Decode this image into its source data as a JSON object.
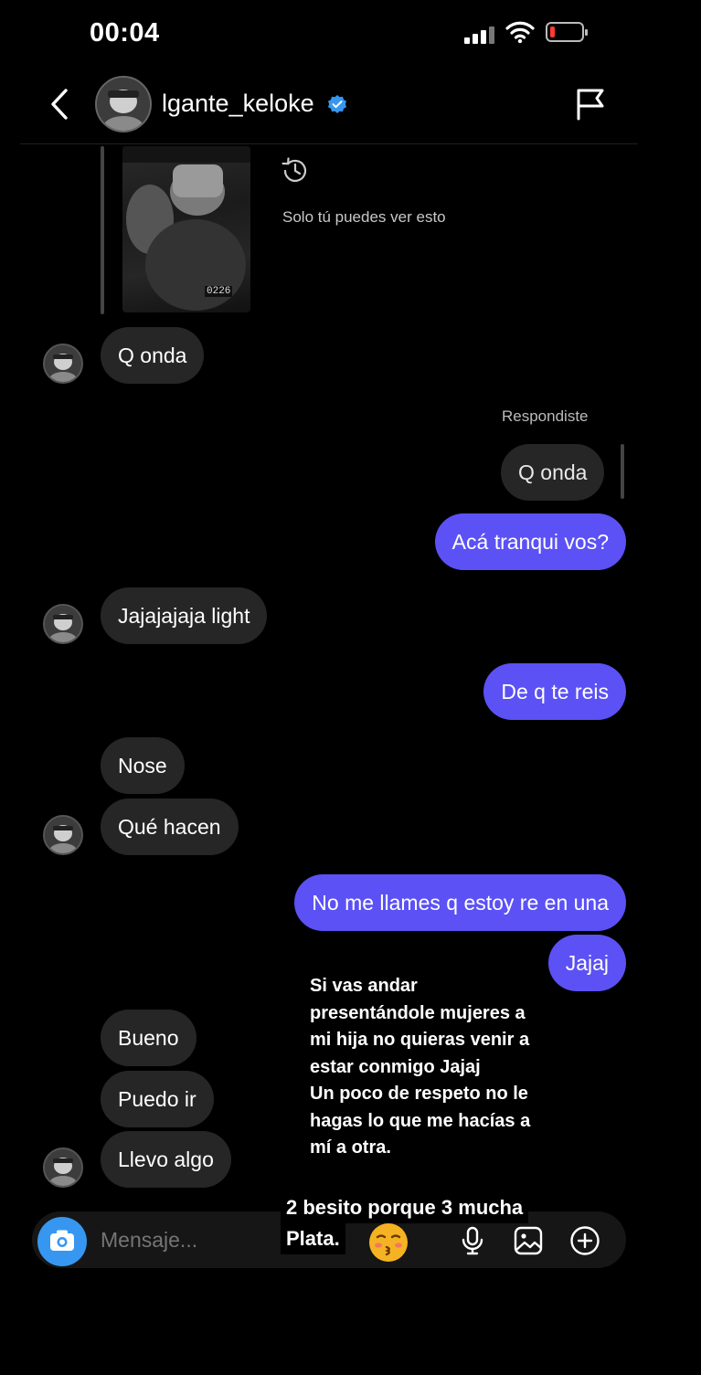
{
  "status_bar": {
    "time": "00:04"
  },
  "header": {
    "username": "lgante_keloke"
  },
  "story": {
    "timer": "0226",
    "note": "Solo tú puedes ver esto"
  },
  "replied_label": "Respondiste",
  "messages": [
    {
      "side": "in",
      "text": "Q onda"
    },
    {
      "side": "echo",
      "text": "Q onda"
    },
    {
      "side": "out",
      "text": "Acá tranqui vos?"
    },
    {
      "side": "in",
      "text": "Jajajajaja light"
    },
    {
      "side": "out",
      "text": "De q te reis"
    },
    {
      "side": "in",
      "text": "Nose"
    },
    {
      "side": "in",
      "text": "Qué hacen"
    },
    {
      "side": "out",
      "text": "No me llames q estoy re en una"
    },
    {
      "side": "out",
      "text": "Jajaj"
    },
    {
      "side": "in",
      "text": "Bueno"
    },
    {
      "side": "in",
      "text": "Puedo ir"
    },
    {
      "side": "in",
      "text": "Llevo algo"
    }
  ],
  "overlay_text": {
    "lines": [
      "Si vas andar",
      "presentándole mujeres a",
      "mi hija no quieras venir a",
      "estar conmigo Jajaj",
      "Un poco de respeto no le",
      "hagas lo que me hacías a",
      "mí a otra."
    ],
    "caption_line1": "2 besito porque 3 mucha",
    "caption_line2": "Plata."
  },
  "composer": {
    "placeholder": "Mensaje..."
  },
  "colors": {
    "outgoing_bubble": "#5b51f5",
    "incoming_bubble": "#262626",
    "camera_button": "#3797f0",
    "verified_badge": "#3797f0",
    "battery_low": "#ff3b30"
  },
  "icons": [
    "back-chevron-icon",
    "verified-badge-icon",
    "flag-icon",
    "replay-icon",
    "camera-icon",
    "microphone-icon",
    "gallery-icon",
    "plus-circle-icon",
    "kissing-face-emoji"
  ]
}
